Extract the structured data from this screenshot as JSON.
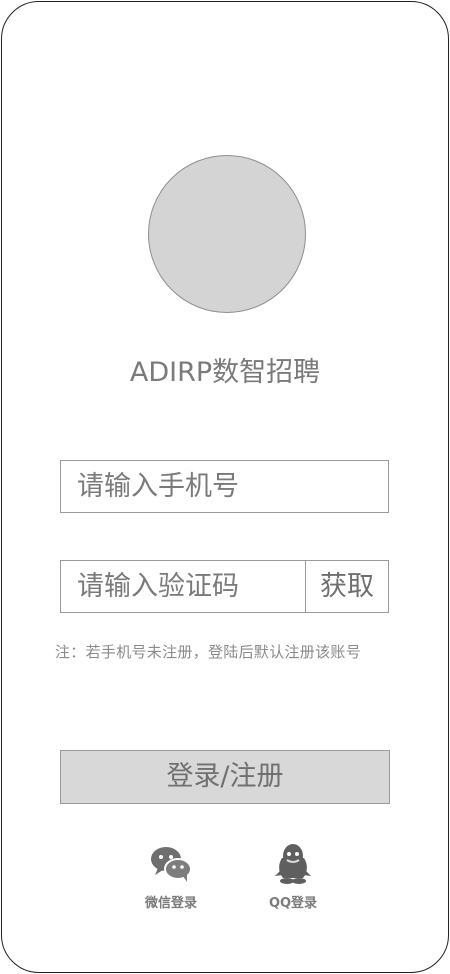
{
  "app": {
    "title": "ADIRP数智招聘"
  },
  "login_form": {
    "phone_placeholder": "请输入手机号",
    "code_placeholder": "请输入验证码",
    "get_code_label": "获取",
    "notice": "注：若手机号未注册，登陆后默认注册该账号",
    "submit_label": "登录/注册"
  },
  "social_login": [
    {
      "label": "微信登录",
      "icon": "wechat-icon"
    },
    {
      "label": "QQ登录",
      "icon": "qq-icon"
    }
  ],
  "colors": {
    "text_gray": "#7a7a7a",
    "border_gray": "#9a9a9a",
    "avatar_fill": "#d4d4d4",
    "button_fill": "#d8d8d8"
  }
}
